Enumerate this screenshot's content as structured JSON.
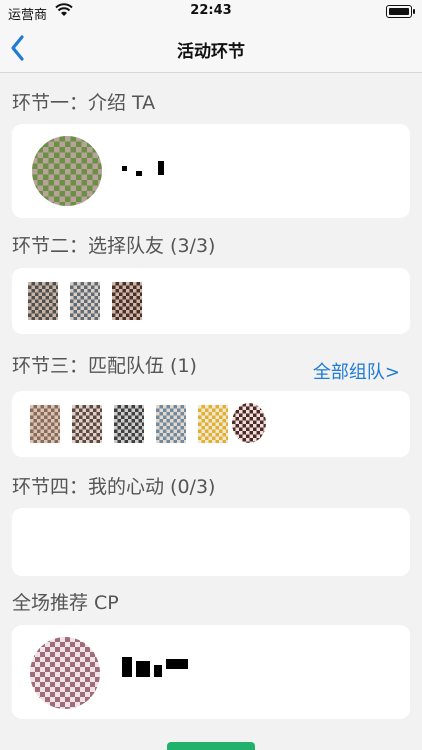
{
  "status_bar": {
    "carrier": "运营商",
    "time": "22:43"
  },
  "nav": {
    "title": "活动环节"
  },
  "sections": {
    "intro": {
      "title": "环节一：介绍 TA"
    },
    "select": {
      "title": "环节二：选择队友 (3/3)"
    },
    "match": {
      "title": "环节三：匹配队伍 (1)",
      "link": "全部组队>"
    },
    "crush": {
      "title": "环节四：我的心动 (0/3)"
    },
    "recommend": {
      "title": "全场推荐 CP"
    }
  },
  "colors": {
    "accent_link": "#1f7bd6",
    "button_green": "#20b26b",
    "background": "#f2f2f2"
  }
}
